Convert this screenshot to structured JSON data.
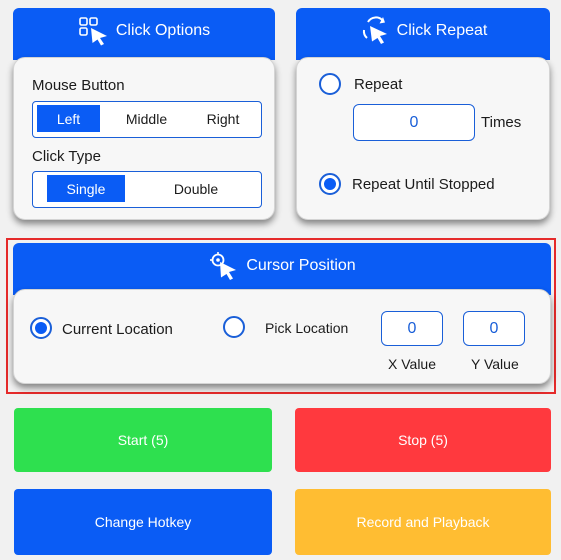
{
  "click_options": {
    "title": "Click Options",
    "icon": "grid-cursor-icon",
    "mouse_button_label": "Mouse Button",
    "mouse_buttons": [
      "Left",
      "Middle",
      "Right"
    ],
    "mouse_button_selected": "Left",
    "click_type_label": "Click Type",
    "click_types": [
      "Single",
      "Double"
    ],
    "click_type_selected": "Single"
  },
  "click_repeat": {
    "title": "Click Repeat",
    "icon": "repeat-cursor-icon",
    "repeat_label": "Repeat",
    "repeat_value": "0",
    "times_label": "Times",
    "until_stopped_label": "Repeat Until Stopped",
    "selected": "until_stopped"
  },
  "cursor_position": {
    "title": "Cursor Position",
    "icon": "target-cursor-icon",
    "current_location_label": "Current Location",
    "pick_location_label": "Pick Location",
    "selected": "current_location",
    "x_value": "0",
    "y_value": "0",
    "x_label": "X Value",
    "y_label": "Y Value"
  },
  "actions": {
    "start": "Start (5)",
    "stop": "Stop (5)",
    "change_hotkey": "Change Hotkey",
    "record_playback": "Record and Playback"
  },
  "colors": {
    "accent_blue": "#0a5cf5",
    "start_green": "#2ee04f",
    "stop_red": "#ff393e",
    "record_yellow": "#ffbd32",
    "highlight_red": "#e52a2a"
  }
}
